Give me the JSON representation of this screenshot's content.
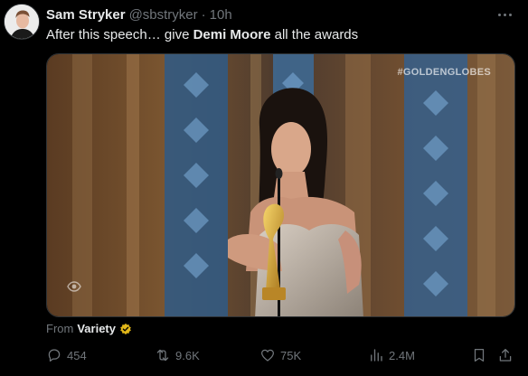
{
  "tweet": {
    "author_name": "Sam Stryker",
    "author_handle": "@sbstryker",
    "separator": "·",
    "time": "10h",
    "text_prefix": "After this speech… give ",
    "text_bold": "Demi Moore",
    "text_suffix": " all the awards"
  },
  "media": {
    "watermark": "#GOLDENGLOBES"
  },
  "source": {
    "prefix": "From",
    "name": "Variety"
  },
  "actions": {
    "replies": "454",
    "reposts": "9.6K",
    "likes": "75K",
    "views": "2.4M"
  },
  "colors": {
    "background": "#000000",
    "text": "#e7e9ea",
    "muted": "#71767b",
    "verified_gold": "#e2b719"
  },
  "icons": [
    "more-icon",
    "reply-icon",
    "repost-icon",
    "like-icon",
    "views-icon",
    "bookmark-icon",
    "share-icon",
    "verified-icon",
    "eye-icon"
  ]
}
